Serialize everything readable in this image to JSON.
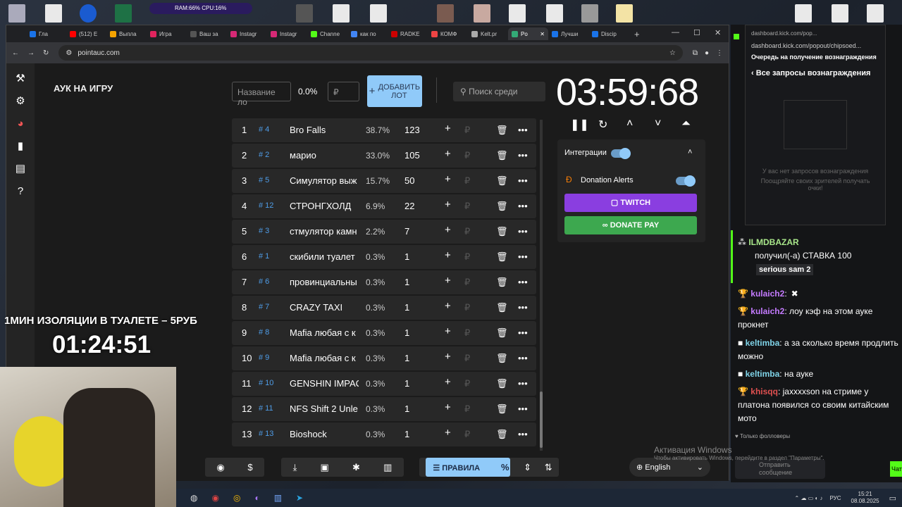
{
  "desktop": {
    "hud": "RAM:66% CPU:16%"
  },
  "browser": {
    "tabs": [
      "Гла",
      "(512) E",
      "Выпла",
      "Игра",
      "Ваш за",
      "Instagr",
      "Instagr",
      "Channe",
      "как по",
      "RADKE",
      "КОМФ",
      "Kelt.pr",
      "Po",
      "Лучши",
      "Discip"
    ],
    "url": "pointauc.com"
  },
  "app": {
    "title": "АУК НА ИГРУ",
    "lot_name_placeholder": "Название ло",
    "lot_percent": "0.0%",
    "lot_amount_placeholder": "₽",
    "add_lot_label": "ДОБАВИТЬ ЛОТ",
    "search_placeholder": "Поиск среди",
    "timer": "03:59:68",
    "lots": [
      {
        "n": "1",
        "id": "# 4",
        "name": "Bro Falls",
        "pct": "38.7%",
        "amount": "123"
      },
      {
        "n": "2",
        "id": "# 2",
        "name": "марио",
        "pct": "33.0%",
        "amount": "105"
      },
      {
        "n": "3",
        "id": "# 5",
        "name": "Симулятор выж",
        "pct": "15.7%",
        "amount": "50"
      },
      {
        "n": "4",
        "id": "# 12",
        "name": "СТРОНГХОЛД",
        "pct": "6.9%",
        "amount": "22"
      },
      {
        "n": "5",
        "id": "# 3",
        "name": "стмулятор камн",
        "pct": "2.2%",
        "amount": "7"
      },
      {
        "n": "6",
        "id": "# 1",
        "name": "скибили туалет",
        "pct": "0.3%",
        "amount": "1"
      },
      {
        "n": "7",
        "id": "# 6",
        "name": "провинциальны",
        "pct": "0.3%",
        "amount": "1"
      },
      {
        "n": "8",
        "id": "# 7",
        "name": "CRAZY TAXI",
        "pct": "0.3%",
        "amount": "1"
      },
      {
        "n": "9",
        "id": "# 8",
        "name": "Mafia любая с к",
        "pct": "0.3%",
        "amount": "1"
      },
      {
        "n": "10",
        "id": "# 9",
        "name": "Mafia любая с к",
        "pct": "0.3%",
        "amount": "1"
      },
      {
        "n": "11",
        "id": "# 10",
        "name": "GENSHIN IMPAC",
        "pct": "0.3%",
        "amount": "1"
      },
      {
        "n": "12",
        "id": "# 11",
        "name": "NFS Shift 2 Unle",
        "pct": "0.3%",
        "amount": "1"
      },
      {
        "n": "13",
        "id": "# 13",
        "name": "Bioshock",
        "pct": "0.3%",
        "amount": "1"
      }
    ],
    "integrations_label": "Интеграции",
    "donation_alerts_label": "Donation Alerts",
    "twitch_label": "TWITCH",
    "donatepay_label": "DONATE PAY",
    "rules_label": "ПРАВИЛА",
    "language": "English"
  },
  "kick": {
    "popup_url": "dashboard.kick.com/pop...",
    "popup_url2": "dashboard.kick.com/popout/chipsoed...",
    "popup_header": "Очередь на получение вознаграждения",
    "popup_back": "Все запросы вознаграждения",
    "popup_empty": "У вас нет запросов вознаграждения",
    "popup_hint": "Поощряйте своих зрителей получать очки!",
    "reward_user": "ILMDBAZAR",
    "reward_text": "получил(-а) СТАВКА 100",
    "reward_item": "serious sam 2",
    "messages": [
      {
        "user": "kulaich2",
        "text": ":"
      },
      {
        "user": "kulaich2",
        "text": ": лоу кэф на этом ауке прокнет"
      },
      {
        "user": "keltimba",
        "text": ": а за сколько время продлить можно"
      },
      {
        "user": "keltimba",
        "text": ": на ауке"
      },
      {
        "user": "khisqq",
        "text": ": jaxxxxson на стриме у платона появился со своим китайским мото"
      }
    ],
    "followers_only": "Только фолловеры",
    "send_placeholder": "Отправить сообщение",
    "chat_button": "Чат"
  },
  "overlay": {
    "promo": "1МИН ИЗОЛЯЦИИ В ТУАЛЕТЕ – 5РУБ",
    "timer": "01:24:51"
  },
  "os": {
    "watermark_title": "Активация Windows",
    "watermark_sub": "Чтобы активировать Windows, перейдите в раздел \"Параметры\".",
    "lang": "РУС",
    "time": "15:21",
    "date": "08.08.2025"
  }
}
